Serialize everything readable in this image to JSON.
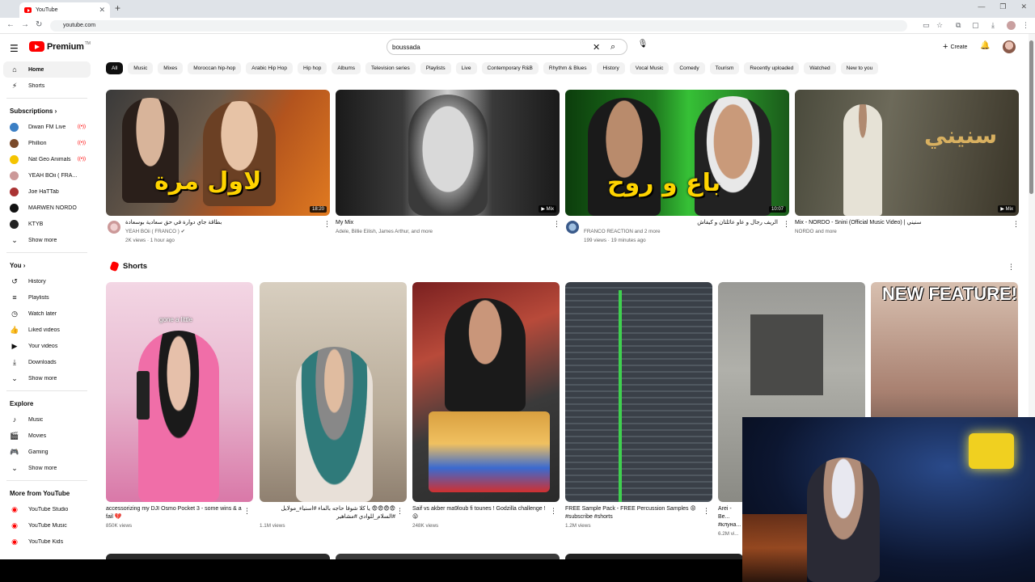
{
  "browser": {
    "tab_title": "YouTube",
    "tab_close": "✕",
    "new_tab": "+",
    "url": "youtube.com",
    "window_controls": [
      "—",
      "❐",
      "✕"
    ]
  },
  "header": {
    "logo_text": "Premium",
    "logo_sup": "TM",
    "search_value": "boussada",
    "create_label": "Create"
  },
  "sidebar": {
    "main": [
      {
        "label": "Home",
        "icon": "home-icon"
      },
      {
        "label": "Shorts",
        "icon": "shorts-icon"
      }
    ],
    "subscriptions_title": "Subscriptions",
    "subscriptions": [
      {
        "label": "Diwan FM Live",
        "live": true,
        "color": "#3b7fc4"
      },
      {
        "label": "Phillion",
        "live": true,
        "color": "#7a4a2a"
      },
      {
        "label": "Nat Geo Animals",
        "live": true,
        "color": "#f5c400"
      },
      {
        "label": "YEAH BOii ( FRA...",
        "live": false,
        "color": "#c99"
      },
      {
        "label": "Joe HaTTab",
        "live": false,
        "color": "#a33"
      },
      {
        "label": "MARWEN NORDO",
        "live": false,
        "color": "#111"
      },
      {
        "label": "KTYB",
        "live": false,
        "color": "#222"
      }
    ],
    "sub_show_more": "Show more",
    "you_title": "You",
    "you_items": [
      {
        "label": "History",
        "icon": "history-icon"
      },
      {
        "label": "Playlists",
        "icon": "playlists-icon"
      },
      {
        "label": "Watch later",
        "icon": "watch-later-icon"
      },
      {
        "label": "Liked videos",
        "icon": "like-icon"
      },
      {
        "label": "Your videos",
        "icon": "your-videos-icon"
      },
      {
        "label": "Downloads",
        "icon": "download-icon"
      },
      {
        "label": "Show more",
        "icon": "chevron-down-icon"
      }
    ],
    "explore_title": "Explore",
    "explore_items": [
      {
        "label": "Music",
        "icon": "music-icon"
      },
      {
        "label": "Movies",
        "icon": "movies-icon"
      },
      {
        "label": "Gaming",
        "icon": "gaming-icon"
      },
      {
        "label": "Show more",
        "icon": "chevron-down-icon"
      }
    ],
    "more_title": "More from YouTube",
    "more_items": [
      {
        "label": "YouTube Studio"
      },
      {
        "label": "YouTube Music"
      },
      {
        "label": "YouTube Kids"
      }
    ]
  },
  "chips": [
    "All",
    "Music",
    "Mixes",
    "Moroccan hip-hop",
    "Arabic Hip Hop",
    "Hip hop",
    "Albums",
    "Television series",
    "Playlists",
    "Live",
    "Contemporary R&B",
    "Rhythm & Blues",
    "History",
    "Vocal Music",
    "Comedy",
    "Tourism",
    "Recently uploaded",
    "Watched",
    "New to you"
  ],
  "videos": [
    {
      "title": "بطاقة جاي دوارة في حق سعادية بوسعادة",
      "channel": "YEAH BOii ( FRANCO )",
      "verified": "✔",
      "meta": "2K views · 1 hour ago",
      "duration": "18:20",
      "overlay": "لاول مرة"
    },
    {
      "title": "My Mix",
      "channel": "Adele, Billie Eilish, James Arthur, and more",
      "meta": "",
      "duration": "▶ Mix",
      "overlay": ""
    },
    {
      "title": "الريف رجال و عاو عائلتان و كيفاش",
      "channel": "FRANCO REACTION and 2 more",
      "meta": "199 views · 19 minutes ago",
      "duration": "10:07",
      "overlay": "باع و روح"
    },
    {
      "title": "Mix - NORDO - Snini (Official Music Video) | سنيني",
      "channel": "NORDO and more",
      "meta": "",
      "duration": "▶ Mix",
      "overlay": "سنيني"
    }
  ],
  "shorts_title": "Shorts",
  "shorts": [
    {
      "title": "accessorizing my DJI Osmo Pocket 3 - some wins & a fail 💔",
      "views": "850K views",
      "caption": "gone a little"
    },
    {
      "title": "😨😨😨😨 يا كلا شوفا حاجه بالماء #اسنياء_مولايل #السلام_للوادي #مشاهير",
      "views": "1.1M views",
      "caption": ""
    },
    {
      "title": "Saif vs akber ma9loub fi tounes ! Godzilla challenge ! 😜",
      "views": "248K views",
      "caption": ""
    },
    {
      "title": "FREE Sample Pack - FREE Percussion Samples 😡 #subscribe #shorts",
      "views": "1.2M views",
      "caption": ""
    },
    {
      "title": "Arei - Be... #клуна...",
      "views": "6.2M vi...",
      "caption": ""
    },
    {
      "title": "",
      "views": "",
      "caption": "NEW FEATURE!"
    }
  ]
}
